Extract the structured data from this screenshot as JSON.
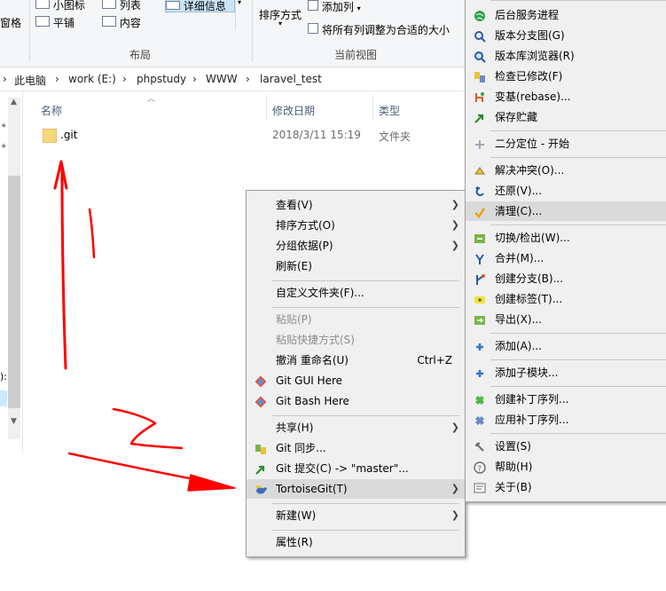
{
  "ribbon": {
    "layout_items": [
      "小图标",
      "列表",
      "详细信息",
      "平铺",
      "内容"
    ],
    "pane_label_fragment": "窗格",
    "group_layout": "布局",
    "sort_label": "排序方式",
    "add_column_label": "添加列",
    "fit_columns_label": "将所有列调整为合适的大小",
    "group_current_view": "当前视图"
  },
  "breadcrumb": [
    "此电脑",
    "work (E:)",
    "phpstudy",
    "WWW",
    "laravel_test"
  ],
  "nav_fragment": "):",
  "columns": {
    "name": "名称",
    "date": "修改日期",
    "type": "类型"
  },
  "files": [
    {
      "name": ".git",
      "date": "2018/3/11 15:19",
      "type": "文件夹"
    }
  ],
  "context_menu": [
    {
      "label": "查看(V)",
      "submenu": true
    },
    {
      "label": "排序方式(O)",
      "submenu": true
    },
    {
      "label": "分组依据(P)",
      "submenu": true
    },
    {
      "label": "刷新(E)"
    },
    {
      "label": "自定义文件夹(F)..."
    },
    {
      "label": "粘贴(P)",
      "disabled": true
    },
    {
      "label": "粘贴快捷方式(S)",
      "disabled": true
    },
    {
      "label": "撤消 重命名(U)",
      "shortcut": "Ctrl+Z"
    },
    {
      "label": "Git GUI Here",
      "icon": "git-diamond-icon"
    },
    {
      "label": "Git Bash Here",
      "icon": "git-diamond-icon"
    },
    {
      "label": "共享(H)",
      "submenu": true
    },
    {
      "label": "Git 同步...",
      "icon": "git-sync-icon"
    },
    {
      "label": "Git 提交(C) -> \"master\"...",
      "icon": "git-commit-icon"
    },
    {
      "label": "TortoiseGit(T)",
      "submenu": true,
      "highlighted": true,
      "icon": "tortoisegit-icon"
    },
    {
      "label": "新建(W)",
      "submenu": true
    },
    {
      "label": "属性(R)"
    }
  ],
  "tortoise_menu": [
    {
      "label": "后台服务进程",
      "icon": "globe-icon"
    },
    {
      "label": "版本分支图(G)",
      "icon": "revision-graph-icon"
    },
    {
      "label": "版本库浏览器(R)",
      "icon": "repo-browser-icon"
    },
    {
      "label": "检查已修改(F)",
      "icon": "check-modifications-icon"
    },
    {
      "label": "变基(rebase)...",
      "icon": "rebase-icon"
    },
    {
      "label": "保存贮藏",
      "icon": "stash-icon"
    },
    {
      "label": "二分定位 - 开始",
      "icon": "bisect-icon"
    },
    {
      "label": "解决冲突(O)...",
      "icon": "resolve-icon"
    },
    {
      "label": "还原(V)...",
      "icon": "revert-icon"
    },
    {
      "label": "清理(C)...",
      "icon": "cleanup-icon",
      "highlighted": true
    },
    {
      "label": "切换/检出(W)...",
      "icon": "switch-icon"
    },
    {
      "label": "合并(M)...",
      "icon": "merge-icon"
    },
    {
      "label": "创建分支(B)...",
      "icon": "branch-icon"
    },
    {
      "label": "创建标签(T)...",
      "icon": "tag-icon"
    },
    {
      "label": "导出(X)...",
      "icon": "export-icon"
    },
    {
      "label": "添加(A)...",
      "icon": "add-icon"
    },
    {
      "label": "添加子模块...",
      "icon": "add-submodule-icon"
    },
    {
      "label": "创建补丁序列...",
      "icon": "create-patch-icon"
    },
    {
      "label": "应用补丁序列...",
      "icon": "apply-patch-icon"
    },
    {
      "label": "设置(S)",
      "icon": "settings-icon"
    },
    {
      "label": "帮助(H)",
      "icon": "help-icon"
    },
    {
      "label": "关于(B)",
      "icon": "about-icon"
    }
  ],
  "colors": {
    "annotation": "#ff0000",
    "highlight": "#dadada",
    "folder": "#f5d77e"
  }
}
